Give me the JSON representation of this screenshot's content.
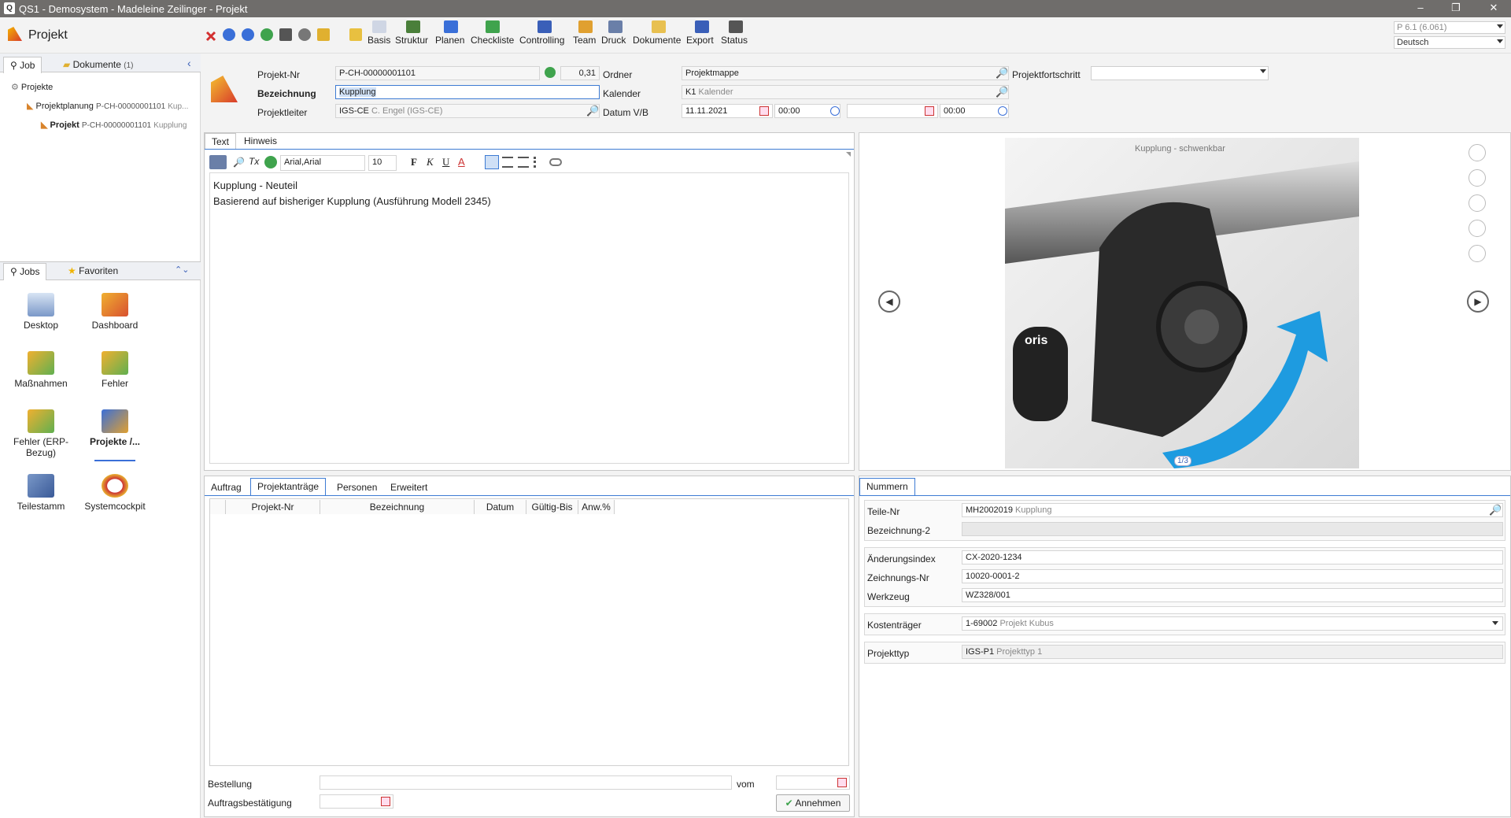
{
  "window": {
    "title": "QS1 - Demosystem - Madeleine Zeilinger - Projekt",
    "minimize": "–",
    "restore": "❐",
    "close": "✕"
  },
  "toolbar": {
    "app_title": "Projekt",
    "buttons": [
      {
        "label": "Basis"
      },
      {
        "label": "Struktur"
      },
      {
        "label": "Planen"
      },
      {
        "label": "Checkliste"
      },
      {
        "label": "Controlling"
      },
      {
        "label": "Team"
      },
      {
        "label": "Druck"
      },
      {
        "label": "Dokumente"
      },
      {
        "label": "Export"
      },
      {
        "label": "Status"
      }
    ],
    "version": "P 6.1 (6.061)",
    "language": "Deutsch"
  },
  "left": {
    "tabs": {
      "job": "Job",
      "dokumente": "Dokumente",
      "dokumente_count": "(1)"
    },
    "tree": {
      "root": "Projekte",
      "planung_label": "Projektplanung",
      "planung_id": "P-CH-00000001101",
      "planung_sub": "Kup...",
      "projekt_label": "Projekt",
      "projekt_id": "P-CH-00000001101",
      "projekt_sub": "Kupplung"
    },
    "jobs_tabs": {
      "jobs": "Jobs",
      "favoriten": "Favoriten"
    },
    "jobs": [
      {
        "label": "Desktop"
      },
      {
        "label": "Dashboard"
      },
      {
        "label": "Maßnahmen"
      },
      {
        "label": "Fehler"
      },
      {
        "label": "Fehler (ERP-Bezug)"
      },
      {
        "label": "Projekte /..."
      },
      {
        "label": "Teilestamm"
      },
      {
        "label": "Systemcockpit"
      }
    ]
  },
  "header": {
    "projekt_nr_label": "Projekt-Nr",
    "projekt_nr": "P-CH-00000001101",
    "progress_value": "0,31",
    "bezeichnung_label": "Bezeichnung",
    "bezeichnung": "Kupplung",
    "projektleiter_label": "Projektleiter",
    "projektleiter_code": "IGS-CE",
    "projektleiter_name": "C. Engel (IGS-CE)",
    "ordner_label": "Ordner",
    "ordner": "Projektmappe",
    "kalender_label": "Kalender",
    "kalender_code": "K1",
    "kalender_name": "Kalender",
    "datum_label": "Datum V/B",
    "datum_von": "11.11.2021",
    "zeit_von": "00:00",
    "datum_bis": "",
    "zeit_bis": "00:00",
    "fortschritt_label": "Projektfortschritt",
    "fortschritt": ""
  },
  "editor": {
    "tabs": {
      "text": "Text",
      "hinweis": "Hinweis"
    },
    "font": "Arial,Arial",
    "size": "10",
    "fmt_bold": "F",
    "fmt_italic": "K",
    "fmt_underline": "U",
    "fmt_color": "A",
    "line1": "Kupplung - Neuteil",
    "line2": "Basierend auf bisheriger Kupplung (Ausführung Modell 2345)"
  },
  "viewer": {
    "caption": "Kupplung - schwenkbar",
    "page": "1/3",
    "brand": "oris"
  },
  "lower_left": {
    "tabs": {
      "auftrag": "Auftrag",
      "projektantraege": "Projektanträge",
      "personen": "Personen",
      "erweitert": "Erweitert"
    },
    "columns": [
      "Projekt-Nr",
      "Bezeichnung",
      "Datum",
      "Gültig-Bis",
      "Anw.%"
    ],
    "bestellung_label": "Bestellung",
    "bestellung": "",
    "vom_label": "vom",
    "vom": "",
    "auftragsbest_label": "Auftragsbestätigung",
    "auftragsbest": "",
    "annehmen": "Annehmen"
  },
  "lower_right": {
    "tab": "Nummern",
    "teile_nr_label": "Teile-Nr",
    "teile_nr": "MH2002019",
    "teile_name": "Kupplung",
    "bez2_label": "Bezeichnung-2",
    "bez2": "",
    "aenderung_label": "Änderungsindex",
    "aenderung": "CX-2020-1234",
    "zeichnung_label": "Zeichnungs-Nr",
    "zeichnung": "10020-0001-2",
    "werkzeug_label": "Werkzeug",
    "werkzeug": "WZ328/001",
    "kostentraeger_label": "Kostenträger",
    "kostentraeger_code": "1-69002",
    "kostentraeger_name": "Projekt Kubus",
    "projekttyp_label": "Projekttyp",
    "projekttyp_code": "IGS-P1",
    "projekttyp_name": "Projekttyp 1"
  },
  "colors": {
    "accent": "#3d7bd3",
    "arrow": "#1e9be0",
    "titlebar": "#6f6d6b"
  }
}
